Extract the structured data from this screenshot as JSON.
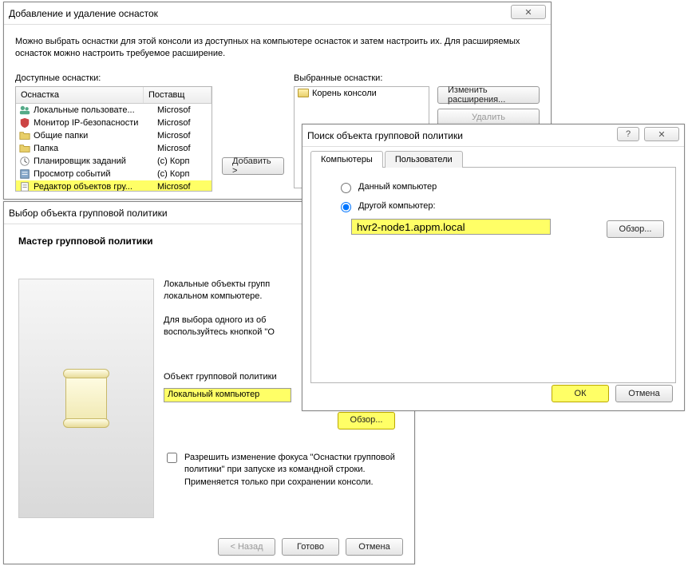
{
  "win1": {
    "title": "Добавление и удаление оснасток",
    "close_glyph": "✕",
    "intro": "Можно выбрать оснастки для этой консоли из доступных на компьютере оснасток и затем настроить их. Для расширяемых оснасток можно настроить требуемое расширение.",
    "available_label": "Доступные оснастки:",
    "selected_label": "Выбранные оснастки:",
    "col_snapin": "Оснастка",
    "col_vendor": "Поставщ",
    "add_btn": "Добавить >",
    "selected_root": "Корень консоли",
    "edit_ext_btn": "Изменить расширения...",
    "delete_btn": "Удалить",
    "snapins": [
      {
        "name": "Локальные пользовате...",
        "vendor": "Microsof",
        "icon": "users"
      },
      {
        "name": "Монитор IP-безопасности",
        "vendor": "Microsof",
        "icon": "shield"
      },
      {
        "name": "Общие папки",
        "vendor": "Microsof",
        "icon": "folder"
      },
      {
        "name": "Папка",
        "vendor": "Microsof",
        "icon": "folder"
      },
      {
        "name": "Планировщик заданий",
        "vendor": "(c) Корп",
        "icon": "clock"
      },
      {
        "name": "Просмотр событий",
        "vendor": "(c) Корп",
        "icon": "event"
      },
      {
        "name": "Редактор объектов гру...",
        "vendor": "Microsof",
        "icon": "policy",
        "hl": true
      }
    ]
  },
  "win2": {
    "title": "Выбор объекта групповой политики",
    "close_glyph": "✕",
    "wizard_heading": "Мастер групповой политики",
    "para1": "Локальные объекты групп\nлокальном компьютере.",
    "para2": "Для выбора одного из об\nвоспользуйтесь кнопкой \"О",
    "field_label": "Объект групповой политики",
    "field_value": "Локальный компьютер",
    "browse_btn": "Обзор...",
    "checkbox_label": "Разрешить изменение фокуса \"Оснастки групповой политики\" при запуске из командной строки. Применяется только при сохранении консоли.",
    "back_btn": "< Назад",
    "finish_btn": "Готово",
    "cancel_btn": "Отмена"
  },
  "win3": {
    "title": "Поиск объекта групповой политики",
    "help_glyph": "?",
    "close_glyph": "✕",
    "tab_computers": "Компьютеры",
    "tab_users": "Пользователи",
    "radio_this": "Данный компьютер",
    "radio_other": "Другой компьютер:",
    "computer_value": "hvr2-node1.appm.local",
    "browse_btn": "Обзор...",
    "ok_btn": "ОК",
    "cancel_btn": "Отмена"
  }
}
